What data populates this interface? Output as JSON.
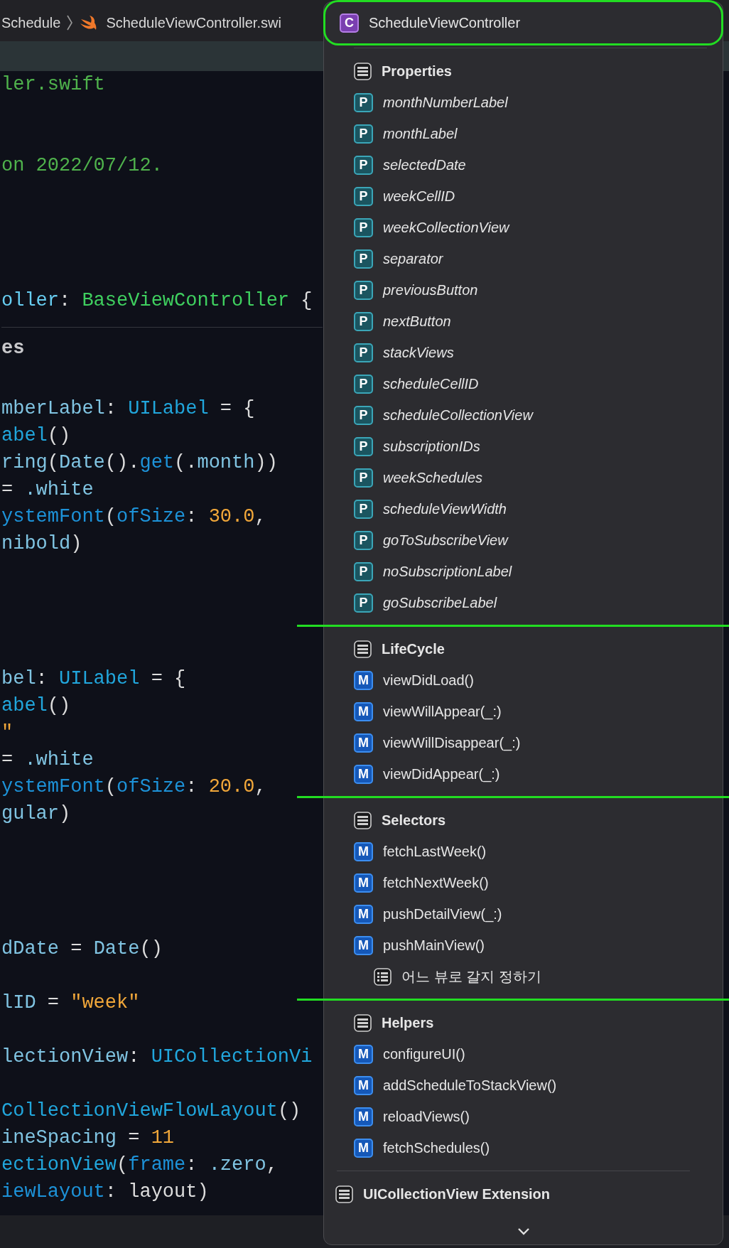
{
  "breadcrumb": {
    "folder": "Schedule",
    "file": "ScheduleViewController.swi"
  },
  "code_lines": [
    {
      "kind": "code",
      "tokens": [
        {
          "kind": "comment",
          "text": "ler.swift"
        }
      ]
    },
    {
      "kind": "blank"
    },
    {
      "kind": "blank"
    },
    {
      "kind": "code",
      "tokens": [
        {
          "kind": "comment",
          "text": "on 2022/07/12."
        }
      ]
    },
    {
      "kind": "blank"
    },
    {
      "kind": "blank"
    },
    {
      "kind": "blank"
    },
    {
      "kind": "blank"
    },
    {
      "kind": "code",
      "tokens": [
        {
          "kind": "decl",
          "text": "oller"
        },
        {
          "kind": "plain",
          "text": ": "
        },
        {
          "kind": "classname",
          "text": "BaseViewController"
        },
        {
          "kind": "plain",
          "text": " {"
        }
      ]
    },
    {
      "kind": "mark",
      "tokens": [
        {
          "kind": "mark",
          "text": "es"
        }
      ]
    },
    {
      "kind": "blank"
    },
    {
      "kind": "code",
      "tokens": [
        {
          "kind": "member",
          "text": "mberLabel"
        },
        {
          "kind": "plain",
          "text": ": "
        },
        {
          "kind": "type",
          "text": "UILabel"
        },
        {
          "kind": "plain",
          "text": " = {"
        }
      ]
    },
    {
      "kind": "code",
      "tokens": [
        {
          "kind": "type",
          "text": "abel"
        },
        {
          "kind": "plain",
          "text": "()"
        }
      ]
    },
    {
      "kind": "code",
      "tokens": [
        {
          "kind": "member",
          "text": "ring"
        },
        {
          "kind": "plain",
          "text": "("
        },
        {
          "kind": "member",
          "text": "Date"
        },
        {
          "kind": "plain",
          "text": "()."
        },
        {
          "kind": "func",
          "text": "get"
        },
        {
          "kind": "plain",
          "text": "(."
        },
        {
          "kind": "member",
          "text": "month"
        },
        {
          "kind": "plain",
          "text": "))"
        }
      ]
    },
    {
      "kind": "code",
      "tokens": [
        {
          "kind": "plain",
          "text": "= "
        },
        {
          "kind": "member",
          "text": ".white"
        }
      ]
    },
    {
      "kind": "code",
      "tokens": [
        {
          "kind": "func",
          "text": "ystemFont"
        },
        {
          "kind": "plain",
          "text": "("
        },
        {
          "kind": "func",
          "text": "ofSize"
        },
        {
          "kind": "plain",
          "text": ": "
        },
        {
          "kind": "number",
          "text": "30.0"
        },
        {
          "kind": "plain",
          "text": ","
        }
      ]
    },
    {
      "kind": "code",
      "tokens": [
        {
          "kind": "member",
          "text": "nibold"
        },
        {
          "kind": "plain",
          "text": ")"
        }
      ]
    },
    {
      "kind": "blank"
    },
    {
      "kind": "blank"
    },
    {
      "kind": "blank"
    },
    {
      "kind": "blank"
    },
    {
      "kind": "code",
      "tokens": [
        {
          "kind": "member",
          "text": "bel"
        },
        {
          "kind": "plain",
          "text": ": "
        },
        {
          "kind": "type",
          "text": "UILabel"
        },
        {
          "kind": "plain",
          "text": " = {"
        }
      ]
    },
    {
      "kind": "code",
      "tokens": [
        {
          "kind": "type",
          "text": "abel"
        },
        {
          "kind": "plain",
          "text": "()"
        }
      ]
    },
    {
      "kind": "code",
      "tokens": [
        {
          "kind": "string",
          "text": "\""
        }
      ]
    },
    {
      "kind": "code",
      "tokens": [
        {
          "kind": "plain",
          "text": "= "
        },
        {
          "kind": "member",
          "text": ".white"
        }
      ]
    },
    {
      "kind": "code",
      "tokens": [
        {
          "kind": "func",
          "text": "ystemFont"
        },
        {
          "kind": "plain",
          "text": "("
        },
        {
          "kind": "func",
          "text": "ofSize"
        },
        {
          "kind": "plain",
          "text": ": "
        },
        {
          "kind": "number",
          "text": "20.0"
        },
        {
          "kind": "plain",
          "text": ","
        }
      ]
    },
    {
      "kind": "code",
      "tokens": [
        {
          "kind": "member",
          "text": "gular"
        },
        {
          "kind": "plain",
          "text": ")"
        }
      ]
    },
    {
      "kind": "blank"
    },
    {
      "kind": "blank"
    },
    {
      "kind": "blank"
    },
    {
      "kind": "blank"
    },
    {
      "kind": "code",
      "tokens": [
        {
          "kind": "member",
          "text": "dDate"
        },
        {
          "kind": "plain",
          "text": " = "
        },
        {
          "kind": "member",
          "text": "Date"
        },
        {
          "kind": "plain",
          "text": "()"
        }
      ]
    },
    {
      "kind": "blank"
    },
    {
      "kind": "code",
      "tokens": [
        {
          "kind": "member",
          "text": "lID"
        },
        {
          "kind": "plain",
          "text": " = "
        },
        {
          "kind": "string",
          "text": "\"week\""
        }
      ]
    },
    {
      "kind": "blank"
    },
    {
      "kind": "code",
      "tokens": [
        {
          "kind": "member",
          "text": "lectionView"
        },
        {
          "kind": "plain",
          "text": ": "
        },
        {
          "kind": "type",
          "text": "UICollectionVi"
        }
      ]
    },
    {
      "kind": "blank"
    },
    {
      "kind": "code",
      "tokens": [
        {
          "kind": "type",
          "text": "CollectionViewFlowLayout"
        },
        {
          "kind": "plain",
          "text": "()"
        }
      ]
    },
    {
      "kind": "code",
      "tokens": [
        {
          "kind": "member",
          "text": "ineSpacing"
        },
        {
          "kind": "plain",
          "text": " = "
        },
        {
          "kind": "number",
          "text": "11"
        }
      ]
    },
    {
      "kind": "code",
      "tokens": [
        {
          "kind": "type",
          "text": "ectionView"
        },
        {
          "kind": "plain",
          "text": "("
        },
        {
          "kind": "func",
          "text": "frame"
        },
        {
          "kind": "plain",
          "text": ": "
        },
        {
          "kind": "member",
          "text": ".zero"
        },
        {
          "kind": "plain",
          "text": ","
        }
      ]
    },
    {
      "kind": "code",
      "tokens": [
        {
          "kind": "func",
          "text": "iewLayout"
        },
        {
          "kind": "plain",
          "text": ": layout)"
        }
      ]
    }
  ],
  "menu": {
    "items": [
      {
        "kind": "class",
        "badge": "C",
        "label": "ScheduleViewController",
        "outlined": true,
        "children": [
          {
            "kind": "mark",
            "label": "Properties",
            "marked": false,
            "children": [
              {
                "kind": "property",
                "badge": "P",
                "label": "monthNumberLabel"
              },
              {
                "kind": "property",
                "badge": "P",
                "label": "monthLabel"
              },
              {
                "kind": "property",
                "badge": "P",
                "label": "selectedDate"
              },
              {
                "kind": "property",
                "badge": "P",
                "label": "weekCellID"
              },
              {
                "kind": "property",
                "badge": "P",
                "label": "weekCollectionView"
              },
              {
                "kind": "property",
                "badge": "P",
                "label": "separator"
              },
              {
                "kind": "property",
                "badge": "P",
                "label": "previousButton"
              },
              {
                "kind": "property",
                "badge": "P",
                "label": "nextButton"
              },
              {
                "kind": "property",
                "badge": "P",
                "label": "stackViews"
              },
              {
                "kind": "property",
                "badge": "P",
                "label": "scheduleCellID"
              },
              {
                "kind": "property",
                "badge": "P",
                "label": "scheduleCollectionView"
              },
              {
                "kind": "property",
                "badge": "P",
                "label": "subscriptionIDs"
              },
              {
                "kind": "property",
                "badge": "P",
                "label": "weekSchedules"
              },
              {
                "kind": "property",
                "badge": "P",
                "label": "scheduleViewWidth"
              },
              {
                "kind": "property",
                "badge": "P",
                "label": "goToSubscribeView"
              },
              {
                "kind": "property",
                "badge": "P",
                "label": "noSubscriptionLabel"
              },
              {
                "kind": "property",
                "badge": "P",
                "label": "goSubscribeLabel"
              }
            ]
          },
          {
            "kind": "mark",
            "label": "LifeCycle",
            "marked": true,
            "children": [
              {
                "kind": "method",
                "badge": "M",
                "label": "viewDidLoad()"
              },
              {
                "kind": "method",
                "badge": "M",
                "label": "viewWillAppear(_:)"
              },
              {
                "kind": "method",
                "badge": "M",
                "label": "viewWillDisappear(_:)"
              },
              {
                "kind": "method",
                "badge": "M",
                "label": "viewDidAppear(_:)"
              }
            ]
          },
          {
            "kind": "mark",
            "label": "Selectors",
            "marked": true,
            "children": [
              {
                "kind": "method",
                "badge": "M",
                "label": "fetchLastWeek()"
              },
              {
                "kind": "method",
                "badge": "M",
                "label": "fetchNextWeek()"
              },
              {
                "kind": "method",
                "badge": "M",
                "label": "pushDetailView(_:)"
              },
              {
                "kind": "method",
                "badge": "M",
                "label": "pushMainView()",
                "children": [
                  {
                    "kind": "note",
                    "label": "어느 뷰로 갈지 정하기"
                  }
                ]
              }
            ]
          },
          {
            "kind": "mark",
            "label": "Helpers",
            "marked": true,
            "children": [
              {
                "kind": "method",
                "badge": "M",
                "label": "configureUI()"
              },
              {
                "kind": "method",
                "badge": "M",
                "label": "addScheduleToStackView()"
              },
              {
                "kind": "method",
                "badge": "M",
                "label": "reloadViews()"
              },
              {
                "kind": "method",
                "badge": "M",
                "label": "fetchSchedules()"
              }
            ]
          }
        ]
      },
      {
        "kind": "mark",
        "label": "UICollectionView Extension",
        "marked": false
      }
    ]
  }
}
